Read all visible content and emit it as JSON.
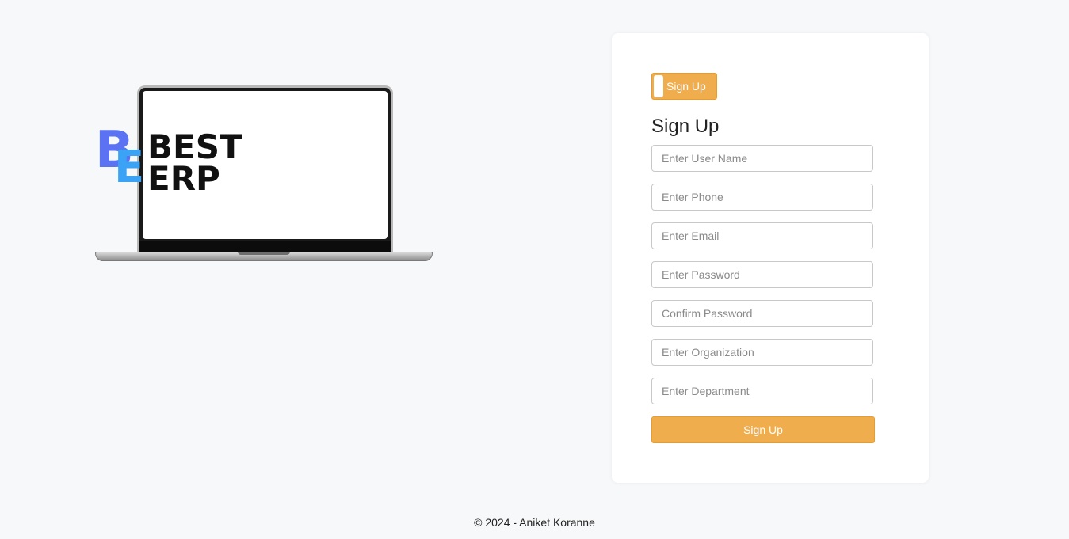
{
  "logo": {
    "letter_b": "B",
    "letter_e": "E",
    "line1": "BEST",
    "line2": "ERP"
  },
  "auth_card": {
    "toggle_label": "Sign Up",
    "title": "Sign Up",
    "fields": {
      "username_placeholder": "Enter User Name",
      "phone_placeholder": "Enter Phone",
      "email_placeholder": "Enter Email",
      "password_placeholder": "Enter Password",
      "confirm_password_placeholder": "Confirm Password",
      "organization_placeholder": "Enter Organization",
      "department_placeholder": "Enter Department"
    },
    "submit_label": "Sign Up"
  },
  "footer": {
    "copyright": "© 2024 - Aniket Koranne"
  },
  "colors": {
    "accent": "#f0ad4e",
    "logo_b": "#5b72f2",
    "logo_e": "#3aa3f5",
    "background": "#f7f8fa"
  }
}
